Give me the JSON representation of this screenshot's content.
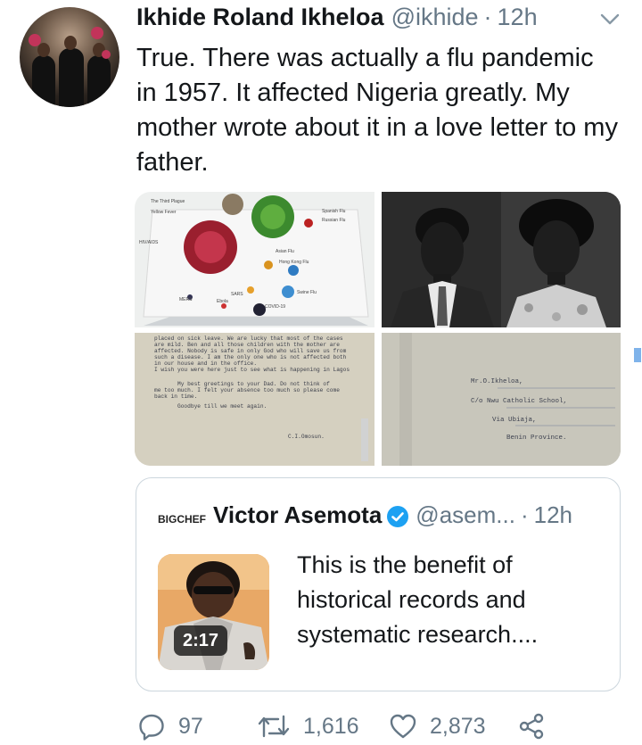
{
  "tweet": {
    "author_name": "Ikhide Roland Ikheloa",
    "author_handle": "@ikhide",
    "separator": "·",
    "time": "12h",
    "text": "True. There was actually a flu pandemic in 1957. It affected Nigeria greatly. My mother wrote about it in a love letter to my father."
  },
  "media": {
    "chart_labels": [
      "The Third Plague",
      "Spanish Flu",
      "Yellow Fever",
      "Russian Flu",
      "HIV/AIDS",
      "Asian Flu",
      "Hong Kong Flu",
      "SARS",
      "Swine Flu",
      "MERS",
      "Ebola",
      "COVID-19"
    ],
    "letter_lines": [
      "placed on sick leave. We are lucky that most of the cases",
      "are mild. Ben and all those children with the mother are",
      "affected. Nobody is safe in only God who will save us from",
      "such a disease. I am the only one who is not affected both",
      "in our house and in the office.",
      "I wish you were here just to see what is happening in Lagos",
      "My best greetings to your Dad. Do not think of",
      "me too much. I felt your absence too much so please come",
      "back in time.",
      "Goodbye till we meet again.",
      "C.I.Omosun."
    ],
    "envelope_lines": [
      "Mr.O.Ikheloa,",
      "C/o Nwu Catholic School,",
      "Via Ubiaja,",
      "Benin Province."
    ]
  },
  "quote": {
    "logo_text": "BIGCHEF",
    "author_name": "Victor Asemota",
    "author_handle": "@asem...",
    "separator": "·",
    "time": "12h",
    "video_duration": "2:17",
    "text": "This is the benefit of historical records and systematic research...."
  },
  "actions": {
    "replies": "97",
    "retweets": "1,616",
    "likes": "2,873"
  },
  "colors": {
    "text": "#14171a",
    "secondary": "#657786",
    "verified": "#1da1f2",
    "border": "#ccd6dd"
  }
}
